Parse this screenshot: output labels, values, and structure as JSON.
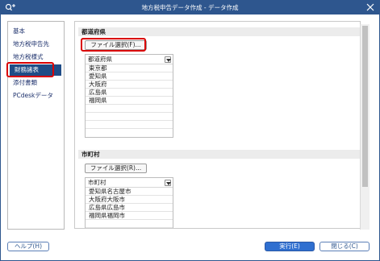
{
  "window": {
    "title": "地方税申告データ作成 - データ作成",
    "app_icon": "search-plus-icon",
    "close_icon": "close-icon"
  },
  "sidebar": {
    "items": [
      {
        "label": "基本"
      },
      {
        "label": "地方税申告先"
      },
      {
        "label": "地方税様式"
      },
      {
        "label": "財務諸表",
        "active": true
      },
      {
        "label": "添付書類"
      },
      {
        "label": "PCdeskデータ"
      }
    ]
  },
  "prefecture": {
    "header": "都道府県",
    "file_button": "ファイル選択(F)...",
    "table_header": "都道府県",
    "rows": [
      "東京都",
      "愛知県",
      "大阪府",
      "広島県",
      "福岡県"
    ]
  },
  "city": {
    "header": "市町村",
    "file_button": "ファイル選択(R)...",
    "table_header": "市町村",
    "rows": [
      "愛知県名古屋市",
      "大阪府大阪市",
      "広島県広島市",
      "福岡県福岡市"
    ]
  },
  "footer": {
    "help": "ヘルプ(H)",
    "execute": "実行(E)",
    "close": "閉じる(C)"
  },
  "colors": {
    "titlebar": "#2e568e",
    "active_item": "#1f4c86",
    "highlight": "#d90000",
    "primary_button": "#2f6fd0"
  }
}
